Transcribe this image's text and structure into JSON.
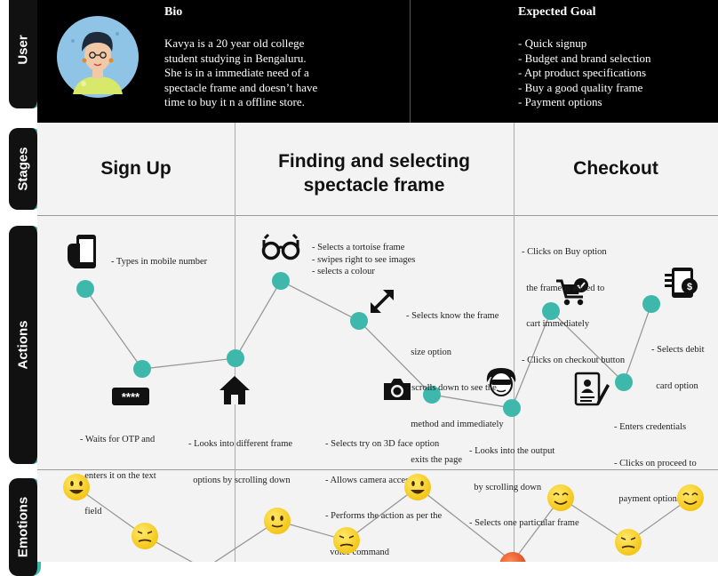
{
  "row_labels": {
    "user": "User",
    "stages": "Stages",
    "actions": "Actions",
    "emotions": "Emotions"
  },
  "bio": {
    "title": "Bio",
    "lines": [
      "Kavya is a 20 year old college",
      "student studying in Bengaluru.",
      "She is in a immediate need of a",
      "spectacle frame and doesn’t have",
      "time to buy it n a offline store."
    ]
  },
  "goal": {
    "title": "Expected Goal",
    "items": [
      "- Quick signup",
      "- Budget and brand selection",
      "- Apt product specifications",
      "- Buy a good quality frame",
      "- Payment options"
    ]
  },
  "stages": {
    "s1": "Sign Up",
    "s2_line1": "Finding and selecting",
    "s2_line2": "spectacle frame",
    "s3": "Checkout"
  },
  "actions": {
    "a1": [
      "- Types in mobile number"
    ],
    "a2": [
      "- Waits for OTP and",
      "  enters it on the text",
      "  field"
    ],
    "a3": [
      "- Looks into different frame",
      "  options by scrolling down"
    ],
    "a4": [
      "- Selects a tortoise frame",
      "- swipes right to see images",
      "- selects a colour"
    ],
    "a5": [
      "- Selects know the frame",
      "  size option",
      "- scrolls down to see the",
      "  method and immediately",
      "  exits the page"
    ],
    "a6": [
      "- Selects try on 3D face option",
      "- Allows camera access",
      "- Performs the action as per the",
      "  voice command"
    ],
    "a7": [
      "- Looks into the output",
      "  by scrolling down",
      "- Selects one particular frame"
    ],
    "a8": [
      "- Clicks on Buy option",
      "  the frame is added to",
      "  cart immediately",
      "- Clicks on checkout button"
    ],
    "a9": [
      "- Enters credentials",
      "- Clicks on proceed to",
      "  payment options"
    ],
    "a10": [
      "- Selects debit",
      "  card option"
    ],
    "otp_text": "****"
  },
  "colors": {
    "accent": "#3fb8ac",
    "header_bg": "#000000",
    "emoji": "#f7d21e",
    "angry": "#e8502a"
  },
  "icons": [
    "phone-icon",
    "password-icon",
    "home-icon",
    "glasses-icon",
    "resize-icon",
    "camera-icon",
    "avatar-glasses-icon",
    "cart-icon",
    "form-icon",
    "payment-phone-icon"
  ],
  "emotions": [
    "happy",
    "sad",
    "sad",
    "neutral",
    "sad",
    "happy",
    "angry",
    "smile",
    "sad",
    "smile"
  ]
}
